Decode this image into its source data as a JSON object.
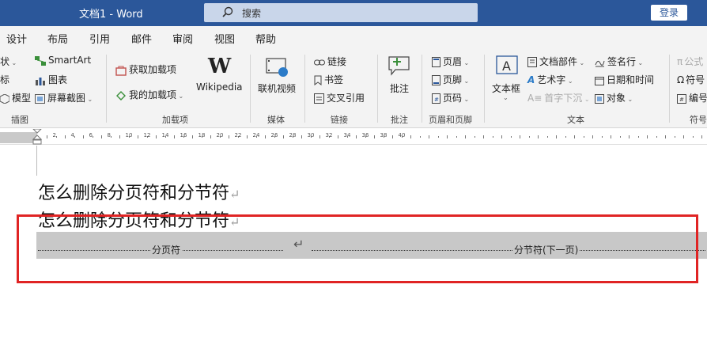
{
  "titlebar": {
    "doc_title": "文档1  -  Word",
    "search_placeholder": "搜索",
    "login_label": "登录"
  },
  "menu": {
    "tabs": [
      "设计",
      "布局",
      "引用",
      "邮件",
      "审阅",
      "视图",
      "帮助"
    ]
  },
  "ribbon": {
    "illustrations": {
      "items": [
        "状",
        "SmartArt",
        "标",
        "图表",
        "模型",
        "屏幕截图"
      ],
      "group_label": "插图"
    },
    "addins": {
      "get_addins": "获取加载项",
      "my_addins": "我的加载项",
      "wikipedia": "Wikipedia",
      "group_label": "加载项"
    },
    "media": {
      "online_video": "联机视频",
      "group_label": "媒体"
    },
    "links": {
      "link": "链接",
      "bookmark": "书签",
      "cross_ref": "交叉引用",
      "group_label": "链接"
    },
    "comments": {
      "comment": "批注",
      "group_label": "批注"
    },
    "header_footer": {
      "header": "页眉",
      "footer": "页脚",
      "page_number": "页码",
      "group_label": "页眉和页脚"
    },
    "text": {
      "textbox": "文本框",
      "quick_parts": "文档部件",
      "wordart": "艺术字",
      "dropcap": "首字下沉",
      "signature": "签名行",
      "datetime": "日期和时间",
      "object": "对象",
      "group_label": "文本"
    },
    "symbols": {
      "equation": "公式",
      "symbol": "符号",
      "number": "编号",
      "group_label": "符号"
    }
  },
  "ruler": {
    "numbers": [
      "2",
      "4",
      "6",
      "8",
      "10",
      "12",
      "14",
      "16",
      "18",
      "20",
      "22",
      "24",
      "26",
      "28",
      "30",
      "32",
      "34",
      "36",
      "38",
      "40"
    ]
  },
  "document": {
    "line1": "怎么删除分页符和分节符",
    "line2": "怎么删除分页符和分节符",
    "paragraph_mark": "↵",
    "page_break_label": "分页符",
    "section_break_label": "分节符(下一页)"
  },
  "colors": {
    "title_bar": "#2b579a",
    "highlight_box": "#e02424",
    "break_bar": "#c8c8c8"
  }
}
